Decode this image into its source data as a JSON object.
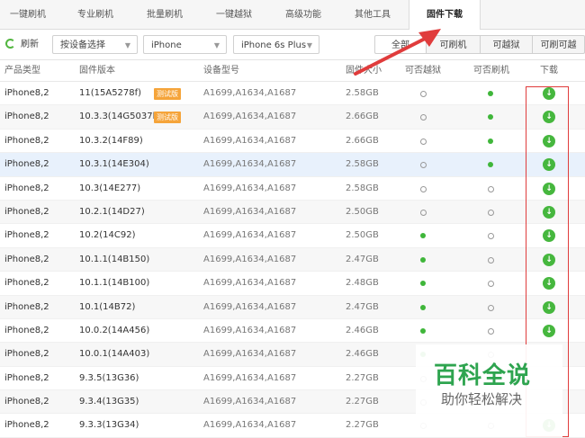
{
  "tabs": [
    "一键刷机",
    "专业刷机",
    "批量刷机",
    "一键越狱",
    "高级功能",
    "其他工具",
    "固件下载"
  ],
  "active_tab": "固件下载",
  "toolbar": {
    "refresh_label": "刷新",
    "device_select": "按设备选择",
    "product_select": "iPhone",
    "model_select": "iPhone 6s Plus",
    "filters": [
      "全部",
      "可刷机",
      "可越狱",
      "可刷可越"
    ]
  },
  "table": {
    "headers": [
      "产品类型",
      "固件版本",
      "设备型号",
      "固件大小",
      "可否越狱",
      "可否刷机",
      "下载"
    ],
    "rows": [
      {
        "type": "iPhone8,2",
        "version": "11(15A5278f)",
        "badge": "测试版",
        "model": "A1699,A1634,A1687",
        "size": "2.58GB",
        "jailbreak": false,
        "flash": true,
        "download": true
      },
      {
        "type": "iPhone8,2",
        "version": "10.3.3(14G5037b)",
        "badge": "测试版",
        "model": "A1699,A1634,A1687",
        "size": "2.66GB",
        "jailbreak": false,
        "flash": true,
        "download": true
      },
      {
        "type": "iPhone8,2",
        "version": "10.3.2(14F89)",
        "badge": "",
        "model": "A1699,A1634,A1687",
        "size": "2.66GB",
        "jailbreak": false,
        "flash": true,
        "download": true
      },
      {
        "type": "iPhone8,2",
        "version": "10.3.1(14E304)",
        "badge": "",
        "model": "A1699,A1634,A1687",
        "size": "2.58GB",
        "jailbreak": false,
        "flash": true,
        "download": true
      },
      {
        "type": "iPhone8,2",
        "version": "10.3(14E277)",
        "badge": "",
        "model": "A1699,A1634,A1687",
        "size": "2.58GB",
        "jailbreak": false,
        "flash": false,
        "download": true
      },
      {
        "type": "iPhone8,2",
        "version": "10.2.1(14D27)",
        "badge": "",
        "model": "A1699,A1634,A1687",
        "size": "2.50GB",
        "jailbreak": false,
        "flash": false,
        "download": true
      },
      {
        "type": "iPhone8,2",
        "version": "10.2(14C92)",
        "badge": "",
        "model": "A1699,A1634,A1687",
        "size": "2.50GB",
        "jailbreak": true,
        "flash": false,
        "download": true
      },
      {
        "type": "iPhone8,2",
        "version": "10.1.1(14B150)",
        "badge": "",
        "model": "A1699,A1634,A1687",
        "size": "2.47GB",
        "jailbreak": true,
        "flash": false,
        "download": true
      },
      {
        "type": "iPhone8,2",
        "version": "10.1.1(14B100)",
        "badge": "",
        "model": "A1699,A1634,A1687",
        "size": "2.48GB",
        "jailbreak": true,
        "flash": false,
        "download": true
      },
      {
        "type": "iPhone8,2",
        "version": "10.1(14B72)",
        "badge": "",
        "model": "A1699,A1634,A1687",
        "size": "2.47GB",
        "jailbreak": true,
        "flash": false,
        "download": true
      },
      {
        "type": "iPhone8,2",
        "version": "10.0.2(14A456)",
        "badge": "",
        "model": "A1699,A1634,A1687",
        "size": "2.46GB",
        "jailbreak": true,
        "flash": false,
        "download": true
      },
      {
        "type": "iPhone8,2",
        "version": "10.0.1(14A403)",
        "badge": "",
        "model": "A1699,A1634,A1687",
        "size": "2.46GB",
        "jailbreak": true,
        "flash": false,
        "download": false
      },
      {
        "type": "iPhone8,2",
        "version": "9.3.5(13G36)",
        "badge": "",
        "model": "A1699,A1634,A1687",
        "size": "2.27GB",
        "jailbreak": false,
        "flash": false,
        "download": false
      },
      {
        "type": "iPhone8,2",
        "version": "9.3.4(13G35)",
        "badge": "",
        "model": "A1699,A1634,A1687",
        "size": "2.27GB",
        "jailbreak": false,
        "flash": false,
        "download": false
      },
      {
        "type": "iPhone8,2",
        "version": "9.3.3(13G34)",
        "badge": "",
        "model": "A1699,A1634,A1687",
        "size": "2.27GB",
        "jailbreak": false,
        "flash": false,
        "download": true
      }
    ]
  },
  "selected_row": 3,
  "watermark": {
    "main": "百科全说",
    "sub": "助你轻松解决"
  },
  "colors": {
    "accent": "#3fb63a",
    "badge": "#f5a43a",
    "annotation": "#e03c3c",
    "selected": "#e8f1fc"
  },
  "icons": {
    "refresh": "refresh-icon",
    "download": "download-icon",
    "dropdown": "chevron-down-icon"
  }
}
